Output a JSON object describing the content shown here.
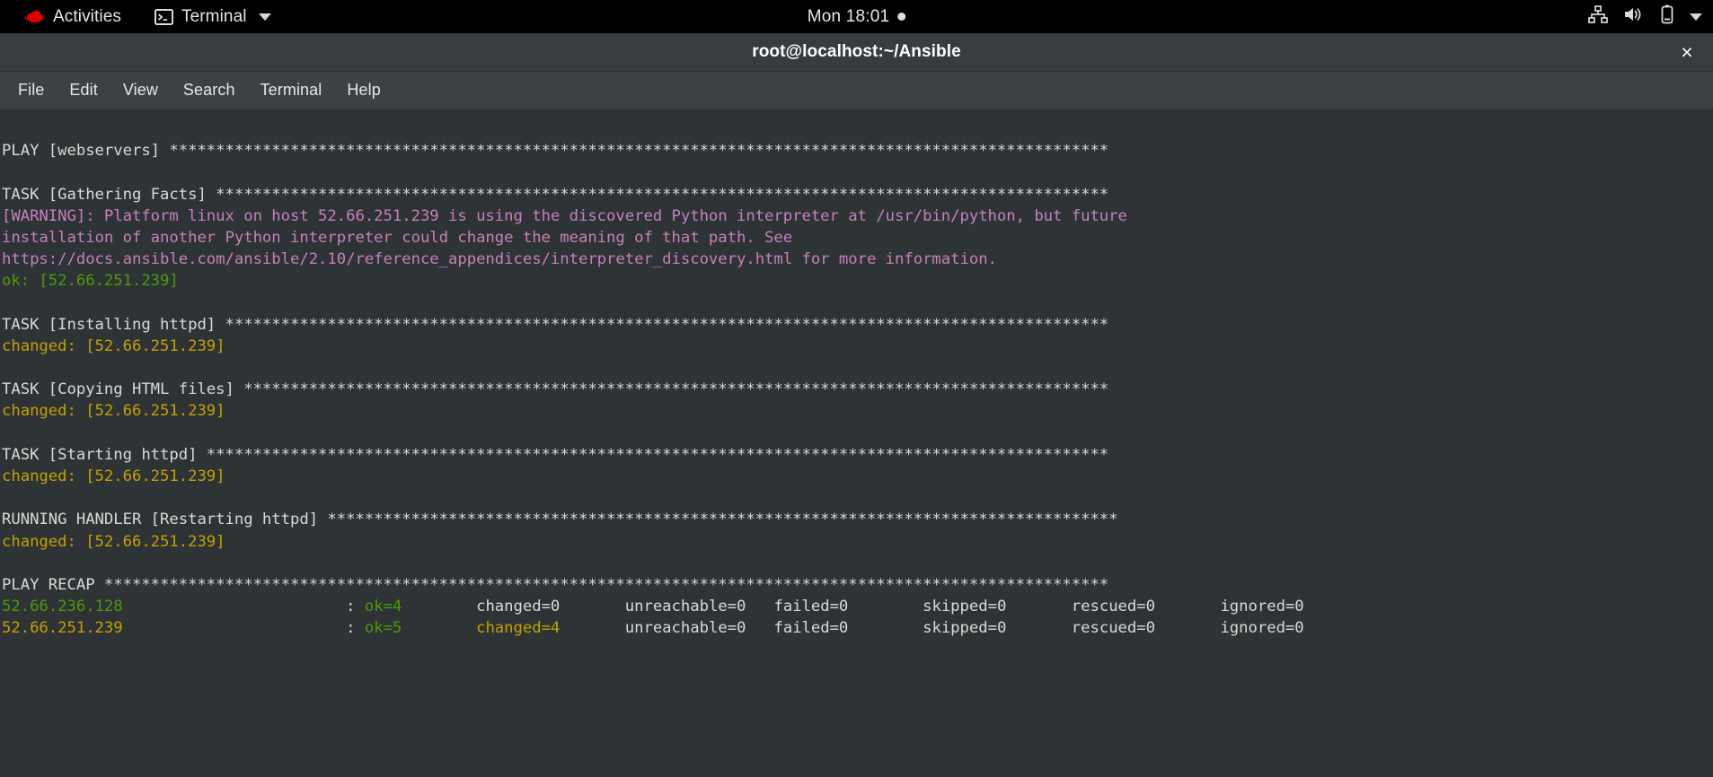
{
  "topbar": {
    "activities_label": "Activities",
    "activities_icon": "redhat-logo-icon",
    "app_label": "Terminal",
    "app_icon": "terminal-icon",
    "app_caret": "chevron-down-icon",
    "clock": "Mon 18:01",
    "clock_dot": "notification-dot-icon",
    "status_icons": [
      "network-wired-icon",
      "volume-speaker-icon",
      "battery-icon",
      "chevron-down-icon"
    ]
  },
  "window": {
    "title": "root@localhost:~/Ansible",
    "close_label": "×"
  },
  "menubar": {
    "items": [
      {
        "label": "File"
      },
      {
        "label": "Edit"
      },
      {
        "label": "View"
      },
      {
        "label": "Search"
      },
      {
        "label": "Terminal"
      },
      {
        "label": "Help"
      }
    ]
  },
  "colors": {
    "white": "#d8dad5",
    "green": "#4e9a06",
    "bright_green": "#63b010",
    "yellow": "#c4a000",
    "magenta": "#c77fbd",
    "terminal_bg": "#2e3436",
    "titlebar_bg": "#373d3f",
    "menubar_bg": "#3c4244",
    "topbar_bg": "#000000"
  },
  "terminal": {
    "stars_full": "***************************************************************************************************************",
    "lines": [
      {
        "type": "blank"
      },
      {
        "type": "play",
        "label": "PLAY [webservers]",
        "stars": "*****************************************************************************************************"
      },
      {
        "type": "blank"
      },
      {
        "type": "play",
        "label": "TASK [Gathering Facts]",
        "stars": "************************************************************************************************"
      },
      {
        "type": "warn",
        "text": "[WARNING]: Platform linux on host 52.66.251.239 is using the discovered Python interpreter at /usr/bin/python, but future"
      },
      {
        "type": "warn",
        "text": "installation of another Python interpreter could change the meaning of that path. See"
      },
      {
        "type": "warn",
        "text": "https://docs.ansible.com/ansible/2.10/reference_appendices/interpreter_discovery.html for more information."
      },
      {
        "type": "status",
        "color": "green",
        "text": "ok: [52.66.251.239]"
      },
      {
        "type": "blank"
      },
      {
        "type": "play",
        "label": "TASK [Installing httpd]",
        "stars": "***********************************************************************************************"
      },
      {
        "type": "status",
        "color": "yellow",
        "text": "changed: [52.66.251.239]"
      },
      {
        "type": "blank"
      },
      {
        "type": "play",
        "label": "TASK [Copying HTML files]",
        "stars": "*********************************************************************************************"
      },
      {
        "type": "status",
        "color": "yellow",
        "text": "changed: [52.66.251.239]"
      },
      {
        "type": "blank"
      },
      {
        "type": "play",
        "label": "TASK [Starting httpd]",
        "stars": "*************************************************************************************************"
      },
      {
        "type": "status",
        "color": "yellow",
        "text": "changed: [52.66.251.239]"
      },
      {
        "type": "blank"
      },
      {
        "type": "play",
        "label": "RUNNING HANDLER [Restarting httpd]",
        "stars": "*************************************************************************************"
      },
      {
        "type": "status",
        "color": "yellow",
        "text": "changed: [52.66.251.239]"
      },
      {
        "type": "blank"
      },
      {
        "type": "play",
        "label": "PLAY RECAP",
        "stars": "************************************************************************************************************"
      }
    ],
    "recap": [
      {
        "host": "52.66.236.128",
        "host_color": "green",
        "sep": ":",
        "stats": [
          {
            "text": "ok=4",
            "color": "green"
          },
          {
            "text": "changed=0",
            "color": "white"
          },
          {
            "text": "unreachable=0",
            "color": "white"
          },
          {
            "text": "failed=0",
            "color": "white"
          },
          {
            "text": "skipped=0",
            "color": "white"
          },
          {
            "text": "rescued=0",
            "color": "white"
          },
          {
            "text": "ignored=0",
            "color": "white"
          }
        ]
      },
      {
        "host": "52.66.251.239",
        "host_color": "yellow",
        "sep": ":",
        "stats": [
          {
            "text": "ok=5",
            "color": "green"
          },
          {
            "text": "changed=4",
            "color": "yellow"
          },
          {
            "text": "unreachable=0",
            "color": "white"
          },
          {
            "text": "failed=0",
            "color": "white"
          },
          {
            "text": "skipped=0",
            "color": "white"
          },
          {
            "text": "rescued=0",
            "color": "white"
          },
          {
            "text": "ignored=0",
            "color": "white"
          }
        ]
      }
    ]
  }
}
